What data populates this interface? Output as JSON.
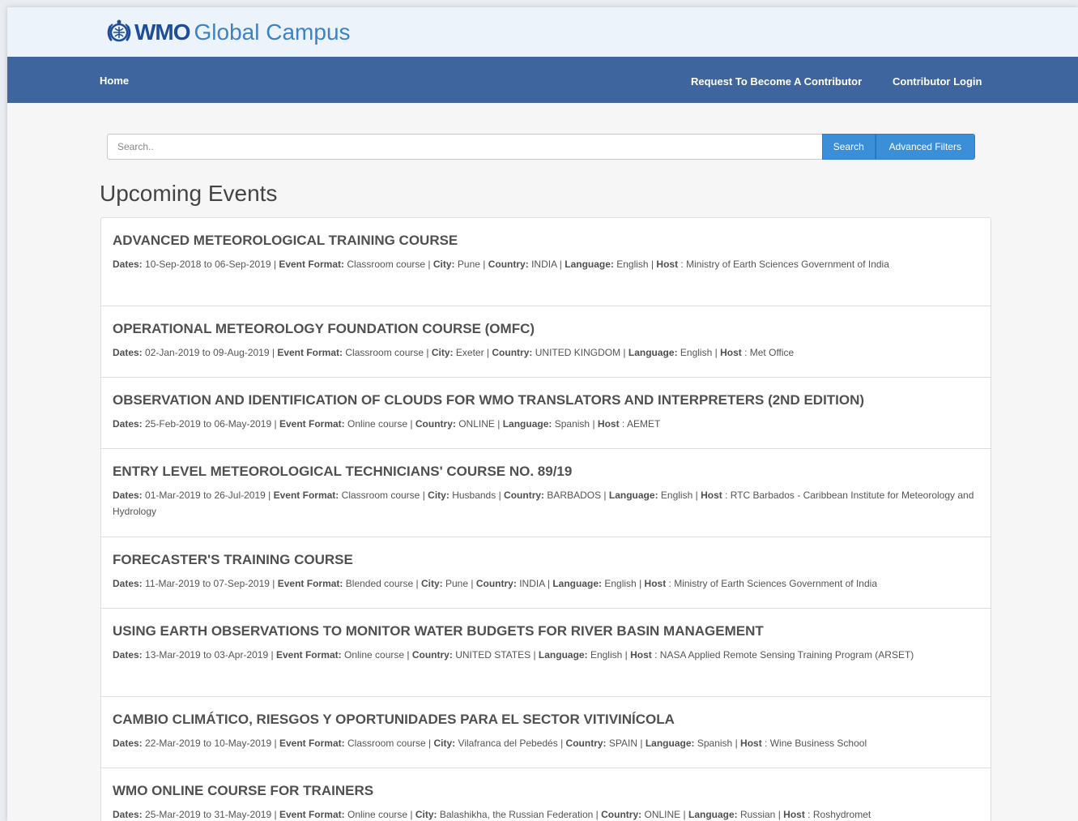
{
  "brand": {
    "logo_bold": "WMO",
    "logo_rest": "Global Campus",
    "accent": "#1d4e97"
  },
  "nav": {
    "home": "Home",
    "request_contributor": "Request To Become A Contributor",
    "contributor_login": "Contributor Login",
    "bar_color": "#3e659d"
  },
  "search": {
    "placeholder": "Search..",
    "search_label": "Search",
    "advanced_label": "Advanced Filters",
    "button_color": "#3b8fd9"
  },
  "section": {
    "title": "Upcoming Events"
  },
  "labels": {
    "dates": "Dates:",
    "format": "Event Format:",
    "city": "City:",
    "country": "Country:",
    "language": "Language:",
    "host": "Host",
    "to": "to",
    "sep": "|"
  },
  "events": [
    {
      "title": "ADVANCED METEOROLOGICAL TRAINING COURSE",
      "start": "10-Sep-2018",
      "end": "06-Sep-2019",
      "format": "Classroom course",
      "city": "Pune",
      "country": "INDIA",
      "language": "English",
      "host": "Ministry of Earth Sciences Government of India"
    },
    {
      "title": "OPERATIONAL METEOROLOGY FOUNDATION COURSE (OMFC)",
      "start": "02-Jan-2019",
      "end": "09-Aug-2019",
      "format": "Classroom course",
      "city": "Exeter",
      "country": "UNITED KINGDOM",
      "language": "English",
      "host": "Met Office"
    },
    {
      "title": "OBSERVATION AND IDENTIFICATION OF CLOUDS FOR WMO TRANSLATORS AND INTERPRETERS (2ND EDITION)",
      "start": "25-Feb-2019",
      "end": "06-May-2019",
      "format": "Online course",
      "city": null,
      "country": "ONLINE",
      "language": "Spanish",
      "host": "AEMET"
    },
    {
      "title": "ENTRY LEVEL METEOROLOGICAL TECHNICIANS' COURSE NO. 89/19",
      "start": "01-Mar-2019",
      "end": "26-Jul-2019",
      "format": "Classroom course",
      "city": "Husbands",
      "country": "BARBADOS",
      "language": "English",
      "host": "RTC Barbados - Caribbean Institute for Meteorology and Hydrology"
    },
    {
      "title": "FORECASTER'S TRAINING COURSE",
      "start": "11-Mar-2019",
      "end": "07-Sep-2019",
      "format": "Blended course",
      "city": "Pune",
      "country": "INDIA",
      "language": "English",
      "host": "Ministry of Earth Sciences Government of India"
    },
    {
      "title": "USING EARTH OBSERVATIONS TO MONITOR WATER BUDGETS FOR RIVER BASIN MANAGEMENT",
      "start": "13-Mar-2019",
      "end": "03-Apr-2019",
      "format": "Online course",
      "city": null,
      "country": "UNITED STATES",
      "language": "English",
      "host": "NASA Applied Remote Sensing Training Program (ARSET)"
    },
    {
      "title": "CAMBIO CLIMÁTICO, RIESGOS Y OPORTUNIDADES PARA EL SECTOR VITIVINÍCOLA",
      "start": "22-Mar-2019",
      "end": "10-May-2019",
      "format": "Classroom course",
      "city": "Vilafranca del Pebedés",
      "country": "SPAIN",
      "language": "Spanish",
      "host": "Wine Business School"
    },
    {
      "title": "WMO ONLINE COURSE FOR TRAINERS",
      "start": "25-Mar-2019",
      "end": "31-May-2019",
      "format": "Online course",
      "city": "Balashikha, the Russian Federation",
      "country": "ONLINE",
      "language": "Russian",
      "host": "Roshydromet"
    }
  ]
}
